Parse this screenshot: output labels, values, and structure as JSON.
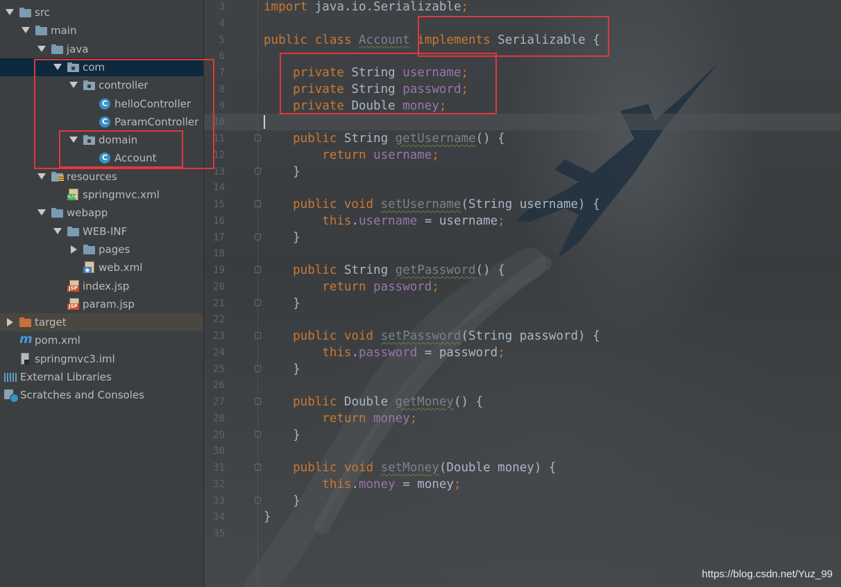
{
  "project_tree": {
    "items": [
      {
        "label": "src",
        "depth": 0,
        "arrow": "down",
        "icon": "folder"
      },
      {
        "label": "main",
        "depth": 1,
        "arrow": "down",
        "icon": "folder"
      },
      {
        "label": "java",
        "depth": 2,
        "arrow": "down",
        "icon": "folder-source"
      },
      {
        "label": "com",
        "depth": 3,
        "arrow": "down",
        "icon": "package",
        "selected": true
      },
      {
        "label": "controller",
        "depth": 4,
        "arrow": "down",
        "icon": "package"
      },
      {
        "label": "helloController",
        "depth": 5,
        "arrow": "none",
        "icon": "class"
      },
      {
        "label": "ParamController",
        "depth": 5,
        "arrow": "none",
        "icon": "class"
      },
      {
        "label": "domain",
        "depth": 4,
        "arrow": "down",
        "icon": "package"
      },
      {
        "label": "Account",
        "depth": 5,
        "arrow": "none",
        "icon": "class"
      },
      {
        "label": "resources",
        "depth": 2,
        "arrow": "down",
        "icon": "folder-resources"
      },
      {
        "label": "springmvc.xml",
        "depth": 3,
        "arrow": "none",
        "icon": "xml"
      },
      {
        "label": "webapp",
        "depth": 2,
        "arrow": "down",
        "icon": "folder"
      },
      {
        "label": "WEB-INF",
        "depth": 3,
        "arrow": "down",
        "icon": "folder"
      },
      {
        "label": "pages",
        "depth": 4,
        "arrow": "right",
        "icon": "folder"
      },
      {
        "label": "web.xml",
        "depth": 4,
        "arrow": "none",
        "icon": "web-xml"
      },
      {
        "label": "index.jsp",
        "depth": 3,
        "arrow": "none",
        "icon": "jsp"
      },
      {
        "label": "param.jsp",
        "depth": 3,
        "arrow": "none",
        "icon": "jsp"
      },
      {
        "label": "target",
        "depth": 0,
        "arrow": "right",
        "icon": "folder-excluded",
        "highlighted": true
      },
      {
        "label": "pom.xml",
        "depth": 0,
        "arrow": "none",
        "icon": "maven"
      },
      {
        "label": "springmvc3.iml",
        "depth": 0,
        "arrow": "none",
        "icon": "iml"
      },
      {
        "label": "External Libraries",
        "depth": -1,
        "arrow": "none",
        "icon": "libraries"
      },
      {
        "label": "Scratches and Consoles",
        "depth": -1,
        "arrow": "none",
        "icon": "scratches"
      }
    ]
  },
  "editor": {
    "first_line_number": 3,
    "current_line": 10,
    "lines": [
      {
        "n": "3",
        "parts": [
          {
            "t": "import ",
            "c": "kw"
          },
          {
            "t": "java.io.Serializable",
            "c": "plain"
          },
          {
            "t": ";",
            "c": "kw"
          }
        ]
      },
      {
        "n": "4",
        "parts": []
      },
      {
        "n": "5",
        "parts": [
          {
            "t": "public class ",
            "c": "kw"
          },
          {
            "t": "Account",
            "c": "unused wavy"
          },
          {
            "t": " ",
            "c": "plain"
          },
          {
            "t": "implements",
            "c": "kw"
          },
          {
            "t": " Serializable {",
            "c": "plain"
          }
        ]
      },
      {
        "n": "6",
        "parts": []
      },
      {
        "n": "7",
        "parts": [
          {
            "t": "    private ",
            "c": "kw"
          },
          {
            "t": "String ",
            "c": "plain"
          },
          {
            "t": "username",
            "c": "fld"
          },
          {
            "t": ";",
            "c": "kw"
          }
        ]
      },
      {
        "n": "8",
        "parts": [
          {
            "t": "    private ",
            "c": "kw"
          },
          {
            "t": "String ",
            "c": "plain"
          },
          {
            "t": "password",
            "c": "fld"
          },
          {
            "t": ";",
            "c": "kw"
          }
        ]
      },
      {
        "n": "9",
        "parts": [
          {
            "t": "    private ",
            "c": "kw"
          },
          {
            "t": "Double ",
            "c": "plain"
          },
          {
            "t": "money",
            "c": "fld"
          },
          {
            "t": ";",
            "c": "kw"
          }
        ]
      },
      {
        "n": "10",
        "parts": []
      },
      {
        "n": "11",
        "fold": "start",
        "parts": [
          {
            "t": "    public ",
            "c": "kw"
          },
          {
            "t": "String ",
            "c": "plain"
          },
          {
            "t": "getUsername",
            "c": "unused wavy"
          },
          {
            "t": "() {",
            "c": "plain"
          }
        ]
      },
      {
        "n": "12",
        "parts": [
          {
            "t": "        return ",
            "c": "kw"
          },
          {
            "t": "username",
            "c": "fld"
          },
          {
            "t": ";",
            "c": "kw"
          }
        ]
      },
      {
        "n": "13",
        "fold": "end",
        "parts": [
          {
            "t": "    }",
            "c": "plain"
          }
        ]
      },
      {
        "n": "14",
        "parts": []
      },
      {
        "n": "15",
        "fold": "start",
        "parts": [
          {
            "t": "    public void ",
            "c": "kw"
          },
          {
            "t": "setUsername",
            "c": "unused wavy"
          },
          {
            "t": "(String username) {",
            "c": "plain"
          }
        ]
      },
      {
        "n": "16",
        "parts": [
          {
            "t": "        this",
            "c": "kw"
          },
          {
            "t": ".",
            "c": "plain"
          },
          {
            "t": "username",
            "c": "fld"
          },
          {
            "t": " = username",
            "c": "plain"
          },
          {
            "t": ";",
            "c": "kw"
          }
        ]
      },
      {
        "n": "17",
        "fold": "end",
        "parts": [
          {
            "t": "    }",
            "c": "plain"
          }
        ]
      },
      {
        "n": "18",
        "parts": []
      },
      {
        "n": "19",
        "fold": "start",
        "parts": [
          {
            "t": "    public ",
            "c": "kw"
          },
          {
            "t": "String ",
            "c": "plain"
          },
          {
            "t": "getPassword",
            "c": "unused wavy"
          },
          {
            "t": "() {",
            "c": "plain"
          }
        ]
      },
      {
        "n": "20",
        "parts": [
          {
            "t": "        return ",
            "c": "kw"
          },
          {
            "t": "password",
            "c": "fld"
          },
          {
            "t": ";",
            "c": "kw"
          }
        ]
      },
      {
        "n": "21",
        "fold": "end",
        "parts": [
          {
            "t": "    }",
            "c": "plain"
          }
        ]
      },
      {
        "n": "22",
        "parts": []
      },
      {
        "n": "23",
        "fold": "start",
        "parts": [
          {
            "t": "    public void ",
            "c": "kw"
          },
          {
            "t": "setPassword",
            "c": "unused wavy"
          },
          {
            "t": "(String password) {",
            "c": "plain"
          }
        ]
      },
      {
        "n": "24",
        "parts": [
          {
            "t": "        this",
            "c": "kw"
          },
          {
            "t": ".",
            "c": "plain"
          },
          {
            "t": "password",
            "c": "fld"
          },
          {
            "t": " = password",
            "c": "plain"
          },
          {
            "t": ";",
            "c": "kw"
          }
        ]
      },
      {
        "n": "25",
        "fold": "end",
        "parts": [
          {
            "t": "    }",
            "c": "plain"
          }
        ]
      },
      {
        "n": "26",
        "parts": []
      },
      {
        "n": "27",
        "fold": "start",
        "parts": [
          {
            "t": "    public ",
            "c": "kw"
          },
          {
            "t": "Double ",
            "c": "plain"
          },
          {
            "t": "getMoney",
            "c": "unused wavy"
          },
          {
            "t": "() {",
            "c": "plain"
          }
        ]
      },
      {
        "n": "28",
        "parts": [
          {
            "t": "        return ",
            "c": "kw"
          },
          {
            "t": "money",
            "c": "fld"
          },
          {
            "t": ";",
            "c": "kw"
          }
        ]
      },
      {
        "n": "29",
        "fold": "end",
        "parts": [
          {
            "t": "    }",
            "c": "plain"
          }
        ]
      },
      {
        "n": "30",
        "parts": []
      },
      {
        "n": "31",
        "fold": "start",
        "parts": [
          {
            "t": "    public void ",
            "c": "kw"
          },
          {
            "t": "setMoney",
            "c": "unused wavy"
          },
          {
            "t": "(Double money) {",
            "c": "plain"
          }
        ]
      },
      {
        "n": "32",
        "parts": [
          {
            "t": "        this",
            "c": "kw"
          },
          {
            "t": ".",
            "c": "plain"
          },
          {
            "t": "money",
            "c": "fld"
          },
          {
            "t": " = money",
            "c": "plain"
          },
          {
            "t": ";",
            "c": "kw"
          }
        ]
      },
      {
        "n": "33",
        "fold": "end",
        "parts": [
          {
            "t": "    }",
            "c": "plain"
          }
        ]
      },
      {
        "n": "34",
        "parts": [
          {
            "t": "}",
            "c": "plain"
          }
        ]
      },
      {
        "n": "35",
        "parts": []
      }
    ]
  },
  "watermark": "https://blog.csdn.net/Yuz_99",
  "colors": {
    "keyword": "#cc7832",
    "field": "#9876aa",
    "default_text": "#a9b7c6",
    "annotation_box": "#e0383d",
    "selection": "#0d293e"
  }
}
